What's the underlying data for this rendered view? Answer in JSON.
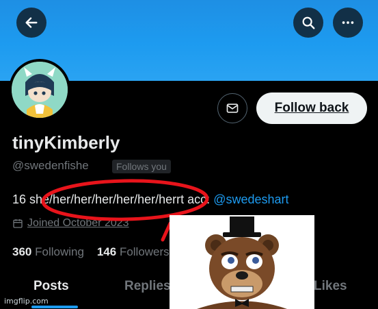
{
  "header": {
    "back_icon": "arrow-left-icon",
    "search_icon": "search-icon",
    "more_icon": "more-horizontal-icon",
    "banner_color": "#1d9bf0"
  },
  "profile": {
    "display_name": "tinyKimberly",
    "handle": "@swedenfishe",
    "follows_you": "Follows you",
    "bio_prefix": "16 sh",
    "bio_pronouns": "e/her/her/her/her/her/her",
    "bio_suffix": "rt acc: ",
    "bio_mention": "@swedeshart",
    "joined": "Joined October 2023",
    "following_count": "360",
    "following_label": "Following",
    "followers_count": "146",
    "followers_label": "Followers"
  },
  "actions": {
    "message_icon": "envelope-icon",
    "follow_back_label": "Follow back"
  },
  "tabs": [
    {
      "label": "Posts",
      "active": true
    },
    {
      "label": "Replies",
      "active": false
    },
    {
      "label": "Likes",
      "active": false
    }
  ],
  "overlay": {
    "annotation_color": "#e8141b"
  },
  "watermark": "imgflip.com"
}
